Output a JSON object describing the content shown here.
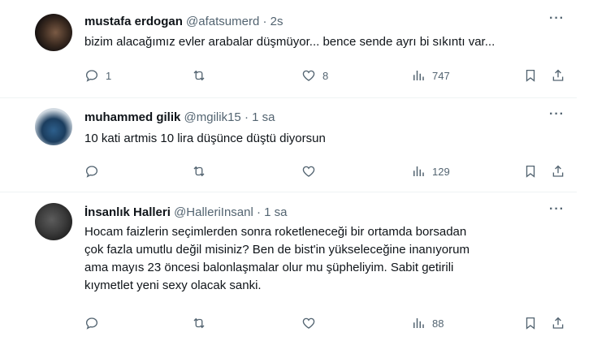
{
  "tweets": [
    {
      "name": "mustafa erdogan",
      "handle": "@afatsumerd",
      "dot": "·",
      "time": "2s",
      "text_lines": [
        "bizim alacağımız evler arabalar düşmüyor... bence sende ayrı bi sıkıntı var..."
      ],
      "replies": "1",
      "retweets": "",
      "likes": "8",
      "views": "747"
    },
    {
      "name": "muhammed gilik",
      "handle": "@mgilik15",
      "dot": "·",
      "time": "1 sa",
      "text_lines": [
        "10 kati artmis 10 lira düşünce düştü diyorsun"
      ],
      "replies": "",
      "retweets": "",
      "likes": "",
      "views": "129"
    },
    {
      "name": "İnsanlık Halleri",
      "handle": "@HalleriInsanl",
      "dot": "·",
      "time": "1 sa",
      "text_lines": [
        "Hocam faizlerin seçimlerden sonra roketleneceği bir ortamda borsadan",
        "çok fazla umutlu değil misiniz? Ben de bist'in yükseleceğine inanıyorum",
        "ama mayıs 23 öncesi balonlaşmalar olur mu şüpheliyim. Sabit getirili",
        "kıymetlet yeni sexy olacak sanki."
      ],
      "replies": "",
      "retweets": "",
      "likes": "",
      "views": "88"
    }
  ],
  "more_glyph": "···",
  "icons": [
    "reply-icon",
    "retweet-icon",
    "like-icon",
    "views-icon",
    "bookmark-icon",
    "share-icon"
  ],
  "colors": {
    "text": "#0f1419",
    "muted": "#536471",
    "separator": "#eff3f4"
  }
}
